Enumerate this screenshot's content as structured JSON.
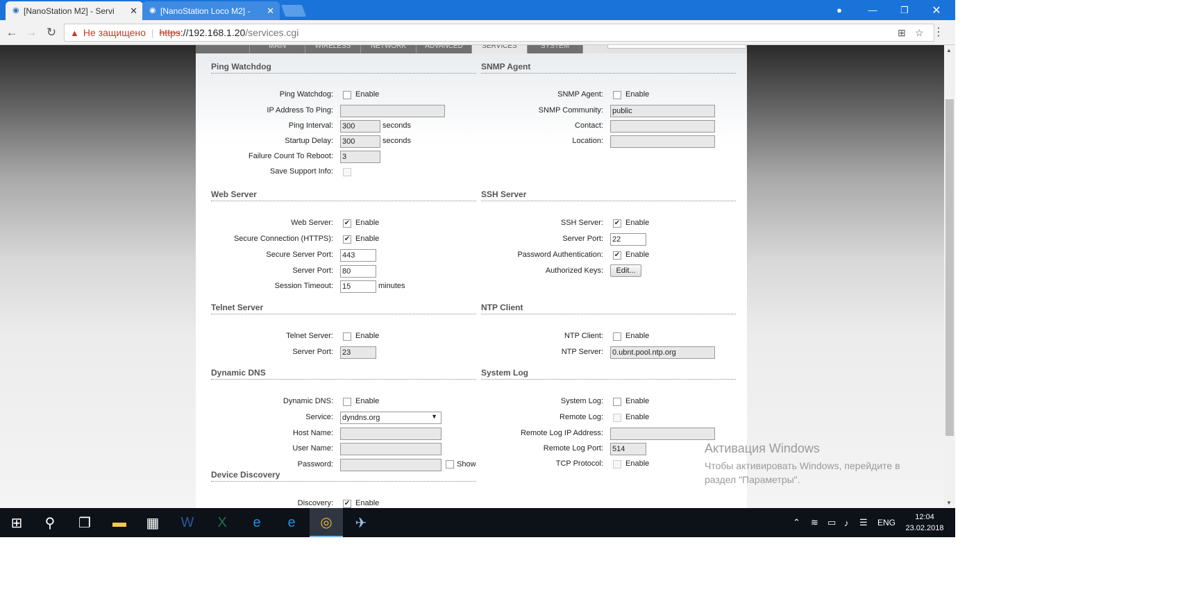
{
  "browser": {
    "tabs": [
      {
        "label": "[NanoStation M2] - Servi"
      },
      {
        "label": "[NanoStation Loco M2] -"
      }
    ],
    "address": {
      "security_label": "Не защищено",
      "scheme": "https",
      "host": "://192.168.1.20",
      "path": "/services.cgi"
    }
  },
  "nav_tabs": [
    "MAIN",
    "WIRELESS",
    "NETWORK",
    "ADVANCED",
    "SERVICES",
    "SYSTEM"
  ],
  "ping_watchdog": {
    "title": "Ping Watchdog",
    "enable_label": "Ping Watchdog:",
    "enable_text": "Enable",
    "ip_label": "IP Address To Ping:",
    "ip_value": "",
    "interval_label": "Ping Interval:",
    "interval_value": "300",
    "interval_unit": "seconds",
    "startup_label": "Startup Delay:",
    "startup_value": "300",
    "startup_unit": "seconds",
    "failure_label": "Failure Count To Reboot:",
    "failure_value": "3",
    "support_label": "Save Support Info:"
  },
  "snmp": {
    "title": "SNMP Agent",
    "enable_label": "SNMP Agent:",
    "enable_text": "Enable",
    "community_label": "SNMP Community:",
    "community_value": "public",
    "contact_label": "Contact:",
    "location_label": "Location:"
  },
  "web_server": {
    "title": "Web Server",
    "enable_label": "Web Server:",
    "enable_text": "Enable",
    "https_label": "Secure Connection (HTTPS):",
    "https_text": "Enable",
    "secure_port_label": "Secure Server Port:",
    "secure_port_value": "443",
    "port_label": "Server Port:",
    "port_value": "80",
    "timeout_label": "Session Timeout:",
    "timeout_value": "15",
    "timeout_unit": "minutes"
  },
  "ssh_server": {
    "title": "SSH Server",
    "enable_label": "SSH Server:",
    "enable_text": "Enable",
    "port_label": "Server Port:",
    "port_value": "22",
    "password_label": "Password Authentication:",
    "password_text": "Enable",
    "keys_label": "Authorized Keys:",
    "keys_button": "Edit..."
  },
  "telnet": {
    "title": "Telnet Server",
    "enable_label": "Telnet Server:",
    "enable_text": "Enable",
    "port_label": "Server Port:",
    "port_value": "23"
  },
  "ntp": {
    "title": "NTP Client",
    "enable_label": "NTP Client:",
    "enable_text": "Enable",
    "server_label": "NTP Server:",
    "server_value": "0.ubnt.pool.ntp.org"
  },
  "ddns": {
    "title": "Dynamic DNS",
    "enable_label": "Dynamic DNS:",
    "enable_text": "Enable",
    "service_label": "Service:",
    "service_value": "dyndns.org",
    "host_label": "Host Name:",
    "user_label": "User Name:",
    "password_label": "Password:",
    "show_text": "Show"
  },
  "syslog": {
    "title": "System Log",
    "enable_label": "System Log:",
    "enable_text": "Enable",
    "remote_label": "Remote Log:",
    "remote_text": "Enable",
    "remote_ip_label": "Remote Log IP Address:",
    "remote_port_label": "Remote Log Port:",
    "remote_port_value": "514",
    "tcp_label": "TCP Protocol:",
    "tcp_text": "Enable"
  },
  "discovery": {
    "title": "Device Discovery",
    "enable_label": "Discovery:",
    "enable_text": "Enable"
  },
  "watermark": {
    "line1": "Активация Windows",
    "line2": "Чтобы активировать Windows, перейдите в раздел \"Параметры\"."
  },
  "taskbar": {
    "lang": "ENG",
    "time": "12:04",
    "date": "23.02.2018"
  }
}
